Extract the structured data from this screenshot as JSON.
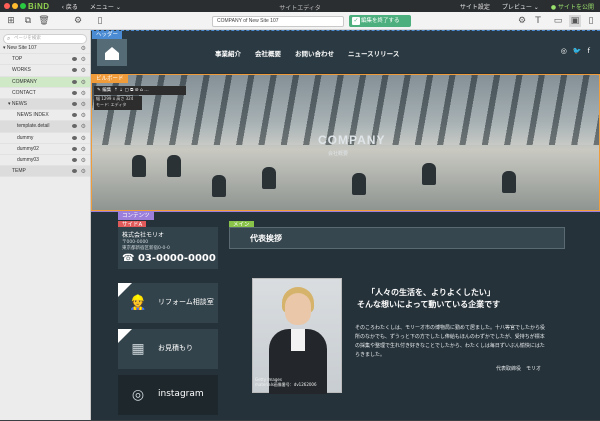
{
  "app": {
    "name": "BiND",
    "back_label": "戻る",
    "menu_label": "メニュー",
    "window_title": "サイトエディタ",
    "site_settings": "サイト設定",
    "preview": "プレビュー",
    "publish": "サイトを公開"
  },
  "toolbar": {
    "address": "COMPANY of New Site 107",
    "end_edit": "編集を終了する"
  },
  "sidebar": {
    "search_placeholder": "ページを検索",
    "items": [
      {
        "label": "New Site 107"
      },
      {
        "label": "TOP"
      },
      {
        "label": "WORKS"
      },
      {
        "label": "COMPANY"
      },
      {
        "label": "CONTACT"
      },
      {
        "label": "NEWS"
      },
      {
        "label": "NEWS INDEX"
      },
      {
        "label": "template.detail"
      },
      {
        "label": "dummy"
      },
      {
        "label": "dummy02"
      },
      {
        "label": "dummy03"
      },
      {
        "label": "TEMP"
      }
    ]
  },
  "header": {
    "tag": "ヘッダー",
    "menu": [
      "事業紹介",
      "会社概要",
      "お問い合わせ",
      "ニュースリリース"
    ]
  },
  "billboard": {
    "tag": "ビルボード",
    "edit": "編集",
    "info1": "幅 1299 x 高さ 324",
    "info2": "モード: エディタ",
    "company": "COMPANY",
    "company_sub": "会社概要"
  },
  "content": {
    "tag": "コンテンツ",
    "side_tag": "サイドA",
    "main_tag": "メイン",
    "company_name": "株式会社モリオ",
    "postal": "〒000-0000",
    "address": "東京都新宿区新宿0-0-0",
    "phone": "03-0000-0000",
    "btn1": "リフォーム相談室",
    "btn2": "お見積もり",
    "btn3": "instagram",
    "title": "代表挨拶",
    "quote1": "「人々の生活を、よりよくしたい」",
    "quote2": "そんな想いによって動いている企業です",
    "body": "そのころわたくしは、モリーオ市の博物局に勤めて居ました。十八等官でしたから役所のなかでも、ずうっと下の方でしたし俸給もほんのわずかでしたが、受持ちが標本の採集や整理で生れ付き好きなことでしたから、わたくしは毎日ずいぶん愉快にはたらきました。",
    "sign": "代表取締役　モリオ",
    "photo_caption1": "Getty Images",
    "photo_caption2": "materials画像番号：dv1262006"
  },
  "colors": {
    "header_tag": "#4a8bd4",
    "billboard_tag": "#f19c3a",
    "content_tag": "#9b7fdb",
    "side_tag": "#e05a5a",
    "main_tag": "#8ac34a"
  }
}
